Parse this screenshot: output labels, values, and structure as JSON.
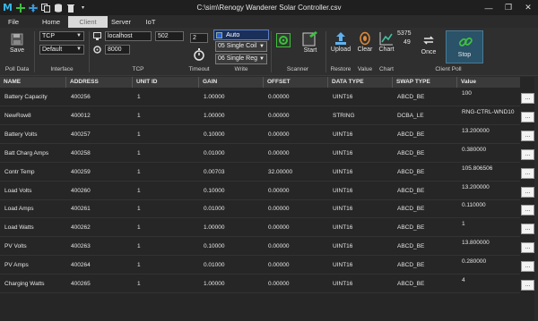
{
  "app": {
    "logo": "M",
    "title": "C:\\sim\\Renogy Wanderer Solar Controller.csv"
  },
  "window_controls": {
    "minimize": "—",
    "restore": "❐",
    "close": "✕"
  },
  "tabs": [
    {
      "label": "File"
    },
    {
      "label": "Home"
    },
    {
      "label": "Client"
    },
    {
      "label": "Server"
    },
    {
      "label": "IoT"
    }
  ],
  "ribbon": {
    "poll_data": {
      "save_label": "Save",
      "group_label": "Poll Data"
    },
    "interface": {
      "protocol": "TCP",
      "mode": "Default",
      "group_label": "Interface"
    },
    "tcp": {
      "host": "localhost",
      "port": "502",
      "secondary_port": "8000",
      "group_label": "TCP"
    },
    "timeout": {
      "value": "2",
      "group_label": "Timeout"
    },
    "write": {
      "auto_label": "Auto",
      "coil_option": "05 Single Coil",
      "reg_option": "06 Single Reg",
      "group_label": "Write"
    },
    "scanner": {
      "group_label": "Scanner"
    },
    "start": {
      "label": "Start"
    },
    "restore": {
      "upload_label": "Upload",
      "group_label": "Restore"
    },
    "value": {
      "clear_label": "Clear",
      "group_label": "Value"
    },
    "chart": {
      "chart_label": "Chart",
      "group_label": "Chart"
    },
    "client_poll": {
      "count_top": "5375",
      "count_bottom": "49",
      "once_label": "Once",
      "stop_label": "Stop",
      "group_label": "Client Poll"
    }
  },
  "colors": {
    "accent_green": "#3fbf3f",
    "accent_blue": "#3a9ad9",
    "upload_blue": "#5fb2f0",
    "clear_orange": "#e08a3a",
    "stop_active": "#2a5268"
  },
  "grid": {
    "columns": [
      "NAME",
      "ADDRESS",
      "UNIT ID",
      "GAIN",
      "OFFSET",
      "DATA TYPE",
      "SWAP TYPE",
      "Value"
    ],
    "rows": [
      [
        "Battery Capacity",
        "400256",
        "1",
        "1.00000",
        "0.00000",
        "UINT16",
        "ABCD_BE",
        "100"
      ],
      [
        "NewRow8",
        "400012",
        "1",
        "1.00000",
        "0.00000",
        "STRING",
        "DCBA_LE",
        "RNG-CTRL-WND10"
      ],
      [
        "Battery Volts",
        "400257",
        "1",
        "0.10000",
        "0.00000",
        "UINT16",
        "ABCD_BE",
        "13.200000"
      ],
      [
        "Batt Charg Amps",
        "400258",
        "1",
        "0.01000",
        "0.00000",
        "UINT16",
        "ABCD_BE",
        "0.380000"
      ],
      [
        "Contr Temp",
        "400259",
        "1",
        "0.00703",
        "32.00000",
        "UINT16",
        "ABCD_BE",
        "105.806506"
      ],
      [
        "Load Volts",
        "400260",
        "1",
        "0.10000",
        "0.00000",
        "UINT16",
        "ABCD_BE",
        "13.200000"
      ],
      [
        "Load Amps",
        "400261",
        "1",
        "0.01000",
        "0.00000",
        "UINT16",
        "ABCD_BE",
        "0.110000"
      ],
      [
        "Load Watts",
        "400262",
        "1",
        "1.00000",
        "0.00000",
        "UINT16",
        "ABCD_BE",
        "1"
      ],
      [
        "PV Volts",
        "400263",
        "1",
        "0.10000",
        "0.00000",
        "UINT16",
        "ABCD_BE",
        "13.800000"
      ],
      [
        "PV Amps",
        "400264",
        "1",
        "0.01000",
        "0.00000",
        "UINT16",
        "ABCD_BE",
        "0.280000"
      ],
      [
        "Charging Watts",
        "400265",
        "1",
        "1.00000",
        "0.00000",
        "UINT16",
        "ABCD_BE",
        "4"
      ]
    ],
    "row_button": "..."
  }
}
